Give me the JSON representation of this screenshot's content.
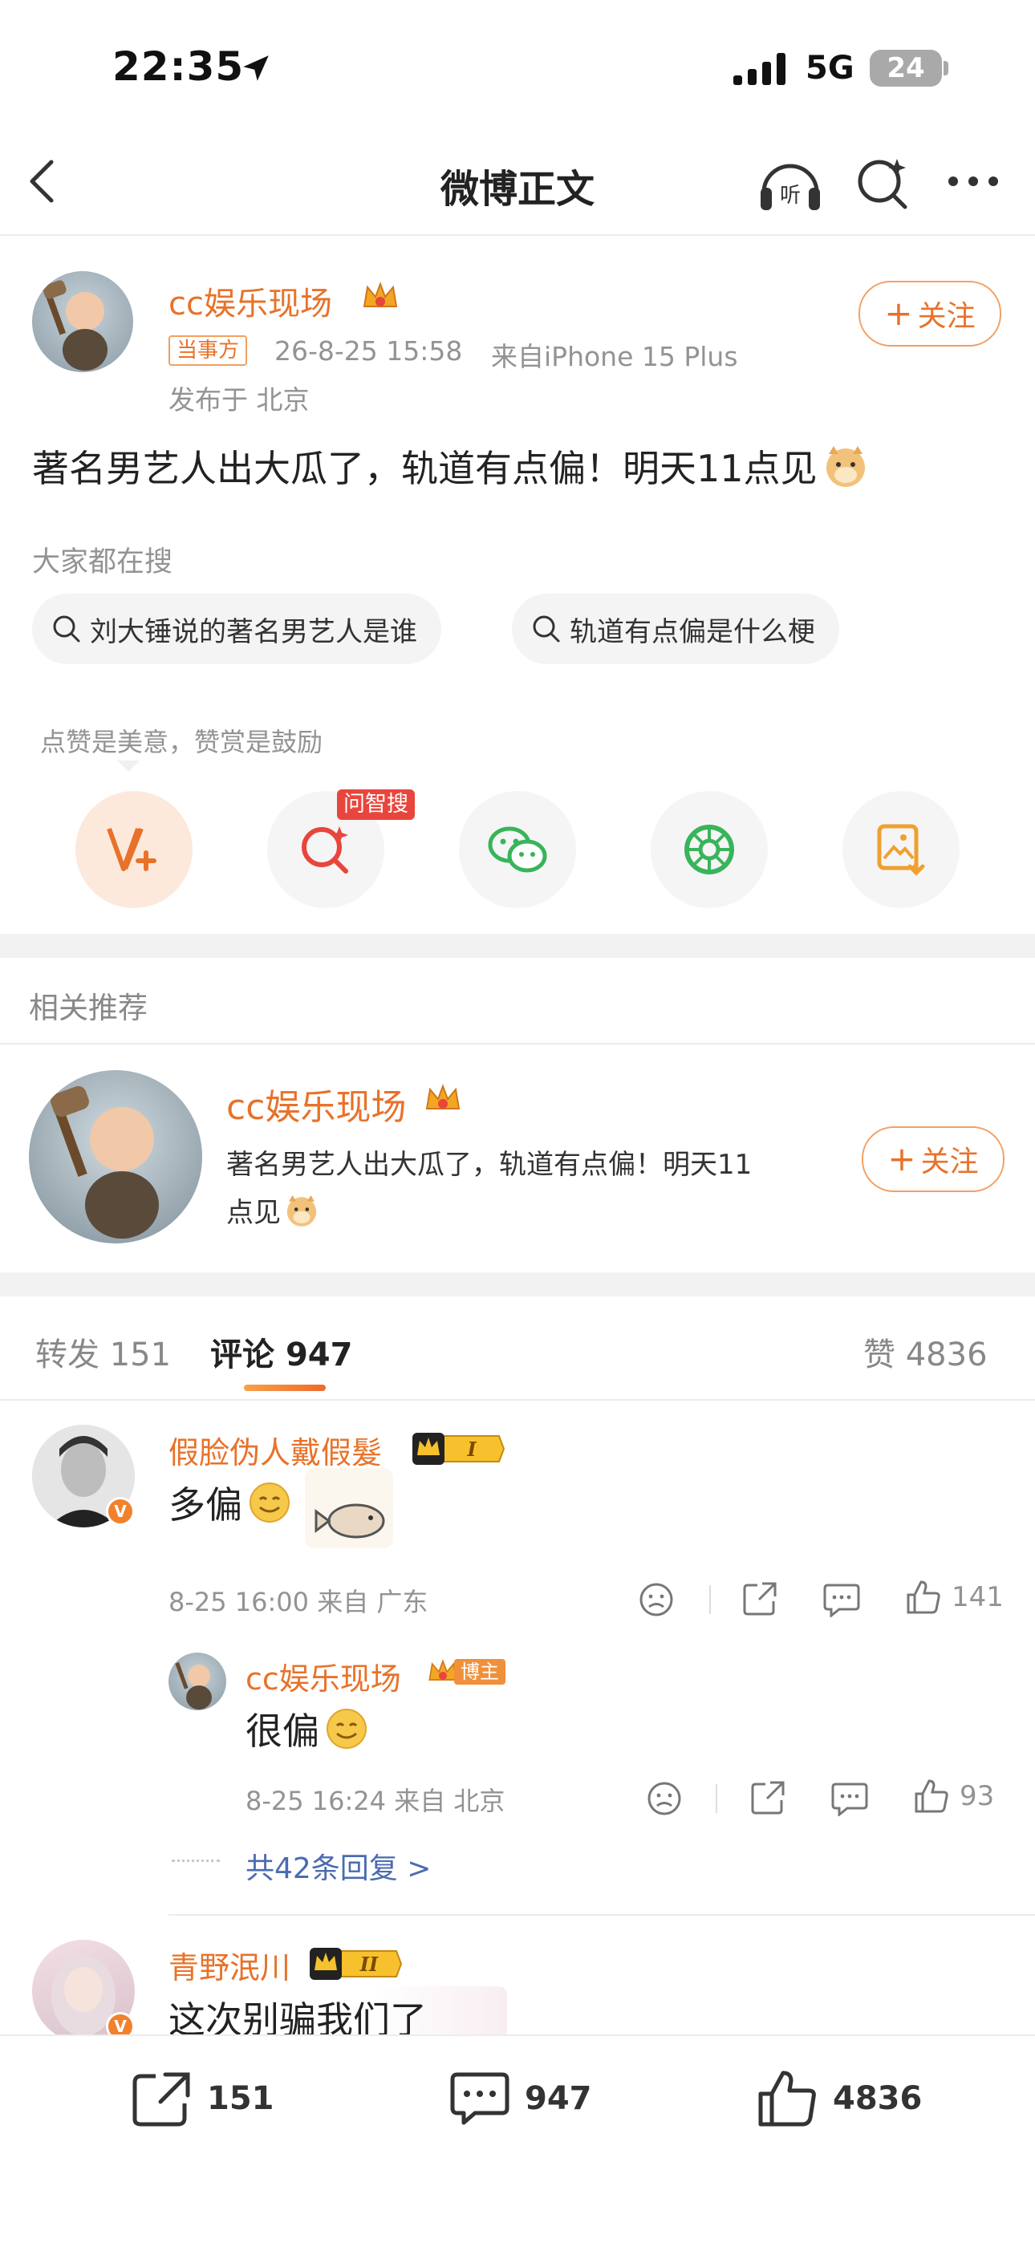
{
  "status_bar": {
    "time": "22:35",
    "network": "5G",
    "battery": "24"
  },
  "nav": {
    "title": "微博正文"
  },
  "post": {
    "author": "cc娱乐现场",
    "tag": "当事方",
    "timestamp": "26-8-25 15:58",
    "source": "来自iPhone 15 Plus",
    "location": "发布于 北京",
    "follow_label": "关注",
    "content": "著名男艺人出大瓜了，轨道有点偏！明天11点见"
  },
  "search": {
    "heading": "大家都在搜",
    "chips": [
      "刘大锤说的著名男艺人是谁",
      "轨道有点偏是什么梗"
    ]
  },
  "reward": {
    "tip": "点赞是美意，赞赏是鼓励",
    "badge": "问智搜"
  },
  "related": {
    "heading": "相关推荐",
    "author": "cc娱乐现场",
    "text_line1": "著名男艺人出大瓜了，轨道有点偏！明天11",
    "text_line2": "点见",
    "follow_label": "关注"
  },
  "tabs": {
    "repost_label": "转发",
    "repost_count": "151",
    "comment_label": "评论",
    "comment_count": "947",
    "like_label": "赞",
    "like_count": "4836"
  },
  "comments": [
    {
      "user": "假脸伪人戴假髮",
      "level": "I",
      "text": "多偏",
      "meta": "8-25 16:00 来自 广东",
      "likes": "141",
      "reply": {
        "user": "cc娱乐现场",
        "badge": "博主",
        "text": "很偏",
        "meta": "8-25 16:24 来自 北京",
        "likes": "93"
      },
      "more_replies": "共42条回复 >"
    },
    {
      "user": "青野泯川",
      "level": "II",
      "text": "这次别骗我们了"
    }
  ],
  "bottom_bar": {
    "repost": "151",
    "comment": "947",
    "like": "4836"
  },
  "colors": {
    "accent": "#e8722a",
    "link": "#4a6baf",
    "grey": "#939393"
  }
}
